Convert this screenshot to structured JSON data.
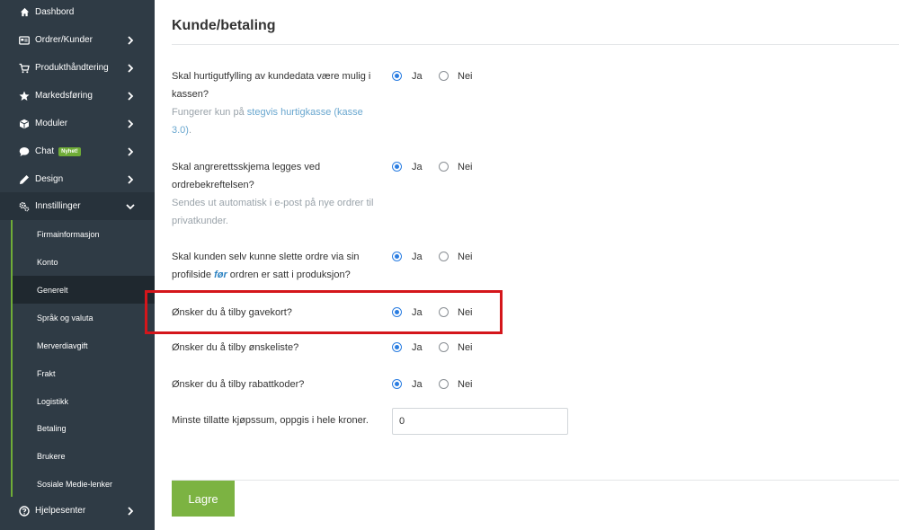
{
  "sidebar": {
    "items": [
      {
        "label": "Dashbord",
        "icon": "home-icon",
        "has_chevron": false
      },
      {
        "label": "Ordrer/Kunder",
        "icon": "card-icon",
        "has_chevron": true
      },
      {
        "label": "Produkthåndtering",
        "icon": "cart-icon",
        "has_chevron": true
      },
      {
        "label": "Markedsføring",
        "icon": "star-icon",
        "has_chevron": true
      },
      {
        "label": "Moduler",
        "icon": "cube-icon",
        "has_chevron": true
      },
      {
        "label": "Chat",
        "icon": "chat-icon",
        "has_chevron": true,
        "badge": "Nyhet!"
      },
      {
        "label": "Design",
        "icon": "pencil-icon",
        "has_chevron": true
      },
      {
        "label": "Innstillinger",
        "icon": "cogs-icon",
        "has_chevron": true,
        "expanded": true
      }
    ],
    "submenu": [
      {
        "label": "Firmainformasjon"
      },
      {
        "label": "Konto"
      },
      {
        "label": "Generelt",
        "active": true
      },
      {
        "label": "Språk og valuta"
      },
      {
        "label": "Merverdiavgift"
      },
      {
        "label": "Frakt"
      },
      {
        "label": "Logistikk"
      },
      {
        "label": "Betaling"
      },
      {
        "label": "Brukere"
      },
      {
        "label": "Sosiale Medie-lenker"
      }
    ],
    "help": {
      "label": "Hjelpesenter",
      "icon": "question-circle-icon"
    },
    "colors": {
      "background": "#2f3b45",
      "accent": "#6fac37",
      "active": "#1f282f"
    }
  },
  "main": {
    "title": "Kunde/betaling",
    "questions": [
      {
        "text": "Skal hurtigutfylling av kundedata være mulig i kassen?",
        "hint_prefix": "Fungerer kun på ",
        "hint_link": "stegvis hurtigkasse (kasse 3.0)",
        "hint_suffix": ".",
        "value": "Ja"
      },
      {
        "text": "Skal angrerettsskjema legges ved ordrebekreftelsen?",
        "hint": "Sendes ut automatisk i e-post på nye ordrer til privatkunder.",
        "value": "Ja"
      },
      {
        "text_before": "Skal kunden selv kunne slette ordre via sin profilside ",
        "text_emphasis": "før",
        "text_after": " ordren er satt i produksjon?",
        "value": "Ja"
      },
      {
        "text": "Ønsker du å tilby gavekort?",
        "value": "Ja"
      },
      {
        "text": "Ønsker du å tilby ønskeliste?",
        "value": "Ja"
      },
      {
        "text": "Ønsker du å tilby rabattkoder?",
        "value": "Ja"
      }
    ],
    "radio_labels": {
      "yes": "Ja",
      "no": "Nei"
    },
    "min_purchase": {
      "label": "Minste tillatte kjøpssum, oppgis i hele kroner.",
      "value": "0"
    },
    "save_label": "Lagre",
    "colors": {
      "save": "#7cb342",
      "radio": "#2a7de1",
      "highlight": "#d4161b"
    }
  }
}
